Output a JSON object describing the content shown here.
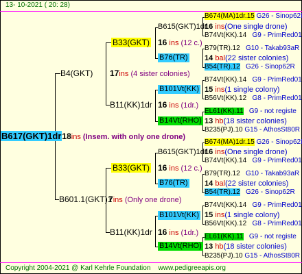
{
  "header": "13- 10-2021 ( 20: 28)",
  "footer": {
    "copyright": "Copyright 2004-2021 @ Karl Kehrle Foundation",
    "url": "www.pedigreeapis.org"
  },
  "root": {
    "name": "B617(GKT)1dr",
    "num": "18",
    "ins": "ins",
    "note": "(Insem. with only one drone)"
  },
  "g1": [
    {
      "name": "B4(GKT)",
      "num": "17",
      "ins": "ins",
      "note": "(4 sister colonies)"
    },
    {
      "name": "B601.1(GKT)1",
      "num": "7",
      "ins": "ins",
      "note": "(Only one drone)"
    }
  ],
  "g2": [
    {
      "name": "B33(GKT)",
      "num": "16",
      "ins": "ins",
      "note": "(12 c.)"
    },
    {
      "name": "B11(KK)1dr",
      "num": "16",
      "ins": "ins",
      "note": "(1dr.)"
    },
    {
      "name": "B33(GKT)",
      "num": "16",
      "ins": "ins",
      "note": "(12 c.)"
    },
    {
      "name": "B11(KK)1dr",
      "num": "16",
      "ins": "ins",
      "note": "(1dr.)"
    }
  ],
  "g3": [
    {
      "name": "B615(GKT)1dr",
      "num": "16",
      "ins": "ins",
      "note": "(One single drone)"
    },
    {
      "name": "B76(TR)",
      "num": "14",
      "ins": "bal",
      "note": "(22 sister colonies)"
    },
    {
      "name": "B101Vt(KK)",
      "num": "15",
      "ins": "ins",
      "note": "(1 single colony)"
    },
    {
      "name": "B14Vt(RHO)",
      "num": "13",
      "ins": "hb",
      "note": "(18 sister colonies)"
    },
    {
      "name": "B615(GKT)1dr",
      "num": "16",
      "ins": "ins",
      "note": "(One single drone)"
    },
    {
      "name": "B76(TR)",
      "num": "14",
      "ins": "bal",
      "note": "(22 sister colonies)"
    },
    {
      "name": "B101Vt(KK)",
      "num": "15",
      "ins": "ins",
      "note": "(1 single colony)"
    },
    {
      "name": "B14Vt(RHO)",
      "num": "13",
      "ins": "hb",
      "note": "(18 sister colonies)"
    }
  ],
  "g4": [
    {
      "name": "B674(MA)1dr.15",
      "ins": "",
      "note": "G26 - Sinop62R"
    },
    {
      "name": "B74Vt(KK).14",
      "ins": "",
      "note": "G9 - PrimRed01"
    },
    {
      "name": "B79(TR).12",
      "ins": "",
      "note": "G10 - Takab93aR"
    },
    {
      "name": "B54(TR).12",
      "ins": "",
      "note": "G26 - Sinop62R"
    },
    {
      "name": "B74Vt(KK).14",
      "ins": "",
      "note": "G9 - PrimRed01"
    },
    {
      "name": "B56Vt(KK).12",
      "ins": "",
      "note": "G8 - PrimRed01"
    },
    {
      "name": "EL61(KK).11",
      "ins": "",
      "note": "G9 - not registe"
    },
    {
      "name": "B235(PJ).10",
      "ins": "",
      "note": "G15 - AthosSt80R"
    },
    {
      "name": "B674(MA)1dr.15",
      "ins": "",
      "note": "G26 - Sinop62R"
    },
    {
      "name": "B74Vt(KK).14",
      "ins": "",
      "note": "G9 - PrimRed01"
    },
    {
      "name": "B79(TR).12",
      "ins": "",
      "note": "G10 - Takab93aR"
    },
    {
      "name": "B54(TR).12",
      "ins": "",
      "note": "G26 - Sinop62R"
    },
    {
      "name": "B74Vt(KK).14",
      "ins": "",
      "note": "G9 - PrimRed01"
    },
    {
      "name": "B56Vt(KK).12",
      "ins": "",
      "note": "G8 - PrimRed01"
    },
    {
      "name": "EL61(KK).11",
      "ins": "",
      "note": "G9 - not registe"
    },
    {
      "name": "B235(PJ).10",
      "ins": "",
      "note": "G15 - AthosSt80R"
    }
  ]
}
